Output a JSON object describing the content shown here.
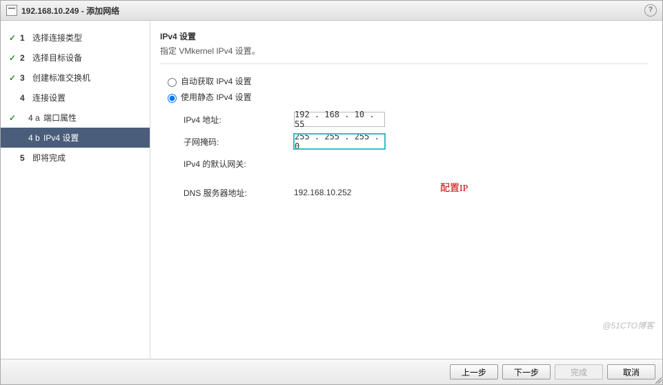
{
  "title": "192.168.10.249 - 添加网络",
  "help_tooltip": "?",
  "sidebar": {
    "steps": [
      {
        "num": "1",
        "label": "选择连接类型",
        "done": true
      },
      {
        "num": "2",
        "label": "选择目标设备",
        "done": true
      },
      {
        "num": "3",
        "label": "创建标准交换机",
        "done": true
      },
      {
        "num": "4",
        "label": "连接设置",
        "done": false
      },
      {
        "num": "5",
        "label": "即将完成",
        "done": false
      }
    ],
    "substeps": [
      {
        "num": "4 a",
        "label": "端口属性",
        "done": true,
        "active": false
      },
      {
        "num": "4 b",
        "label": "IPv4 设置",
        "done": false,
        "active": true
      }
    ]
  },
  "content": {
    "title": "IPv4 设置",
    "subtitle": "指定 VMkernel IPv4 设置。",
    "radio_auto": "自动获取 IPv4 设置",
    "radio_static": "使用静态 IPv4 设置",
    "radio_selected": "static",
    "fields": {
      "ipv4_addr_label": "IPv4 地址:",
      "ipv4_addr_value": "192 . 168 .  10 .  55",
      "subnet_label": "子网掩码:",
      "subnet_value": "255 . 255 . 255 .  0",
      "gateway_label": "IPv4 的默认网关:",
      "gateway_value": "",
      "dns_label": "DNS 服务器地址:",
      "dns_value": "192.168.10.252"
    },
    "annotation": "配置IP"
  },
  "footer": {
    "back": "上一步",
    "next": "下一步",
    "finish": "完成",
    "cancel": "取消"
  },
  "watermark": "@51CTO博客"
}
